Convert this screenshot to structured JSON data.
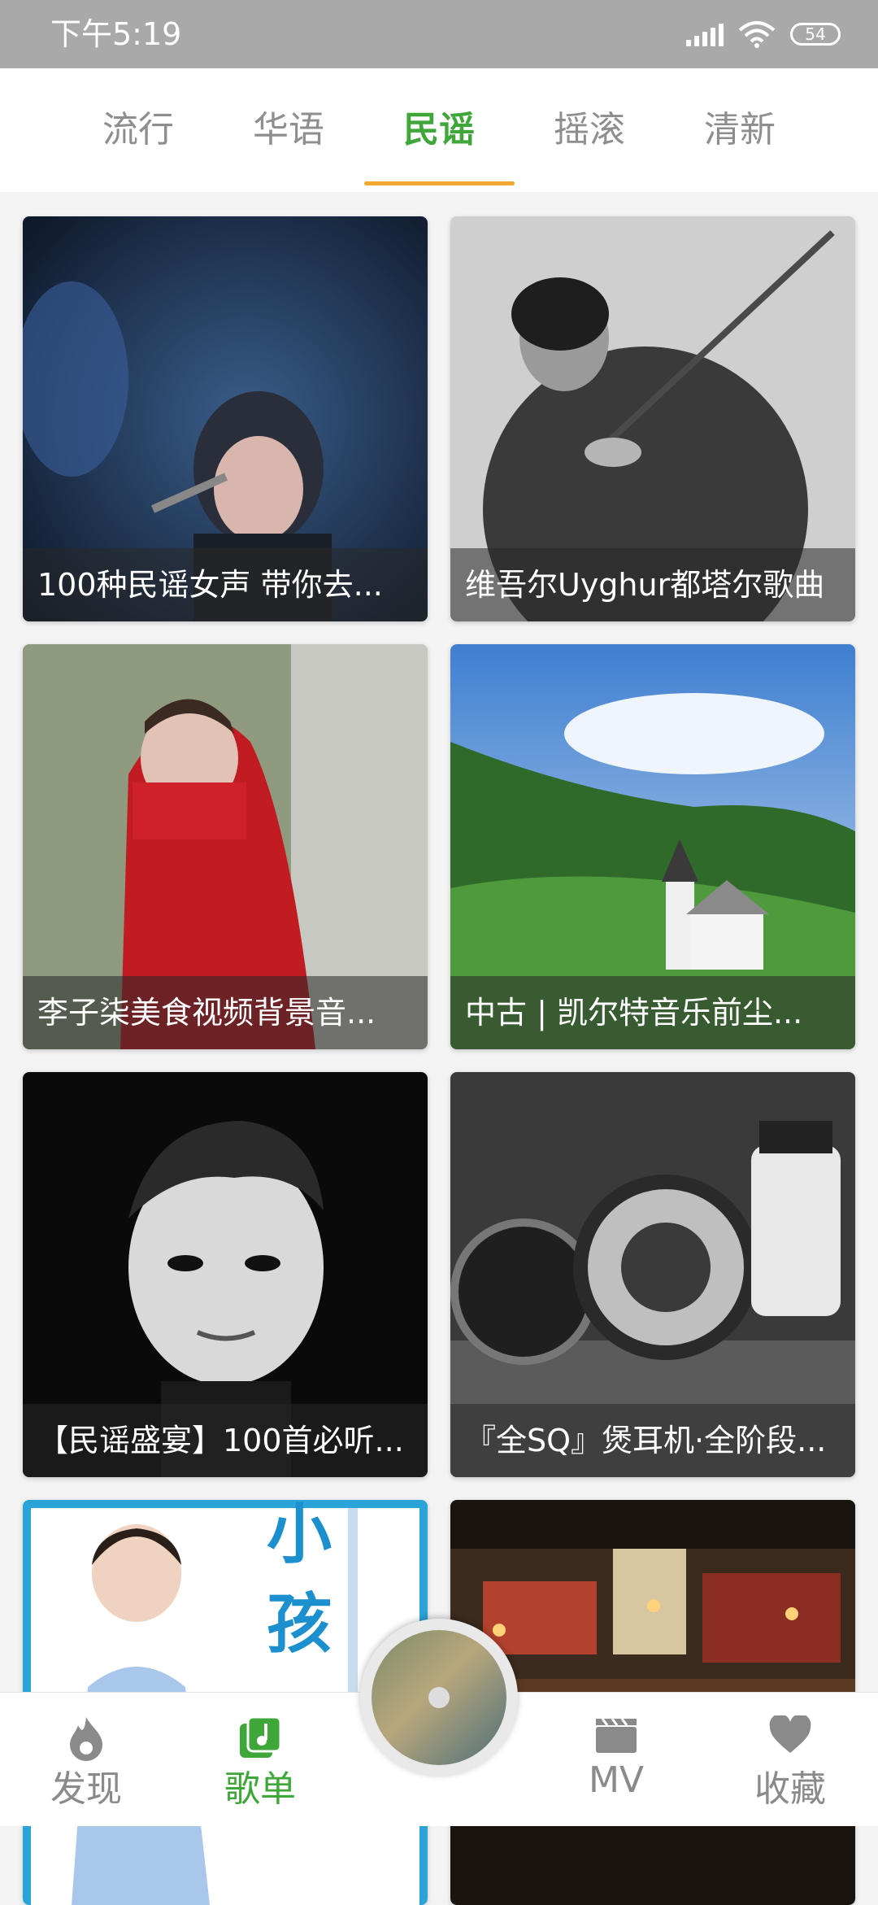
{
  "status_bar": {
    "time": "下午5:19",
    "battery": "54"
  },
  "tabs": [
    {
      "label": "流行"
    },
    {
      "label": "华语"
    },
    {
      "label": "民谣",
      "active": true
    },
    {
      "label": "摇滚"
    },
    {
      "label": "清新"
    }
  ],
  "playlists": [
    {
      "title": "100种民谣女声 带你去..."
    },
    {
      "title": "维吾尔Uyghur都塔尔歌曲"
    },
    {
      "title": "李子柒美食视频背景音..."
    },
    {
      "title": "中古 | 凯尔特音乐前尘..."
    },
    {
      "title": "【民谣盛宴】100首必听..."
    },
    {
      "title": "『全SQ』煲耳机·全阶段..."
    },
    {
      "title": ""
    },
    {
      "title": ""
    }
  ],
  "artwork_text": {
    "card7": "小孩"
  },
  "bottom_nav": [
    {
      "label": "发现",
      "icon": "flame-icon"
    },
    {
      "label": "歌单",
      "icon": "music-note-icon",
      "active": true
    },
    {
      "label": "MV",
      "icon": "clapper-icon"
    },
    {
      "label": "收藏",
      "icon": "heart-icon"
    }
  ],
  "colors": {
    "accent": "#3fa63a",
    "tab_indicator": "#f2a72e",
    "status_bar": "#a9a9a9"
  }
}
